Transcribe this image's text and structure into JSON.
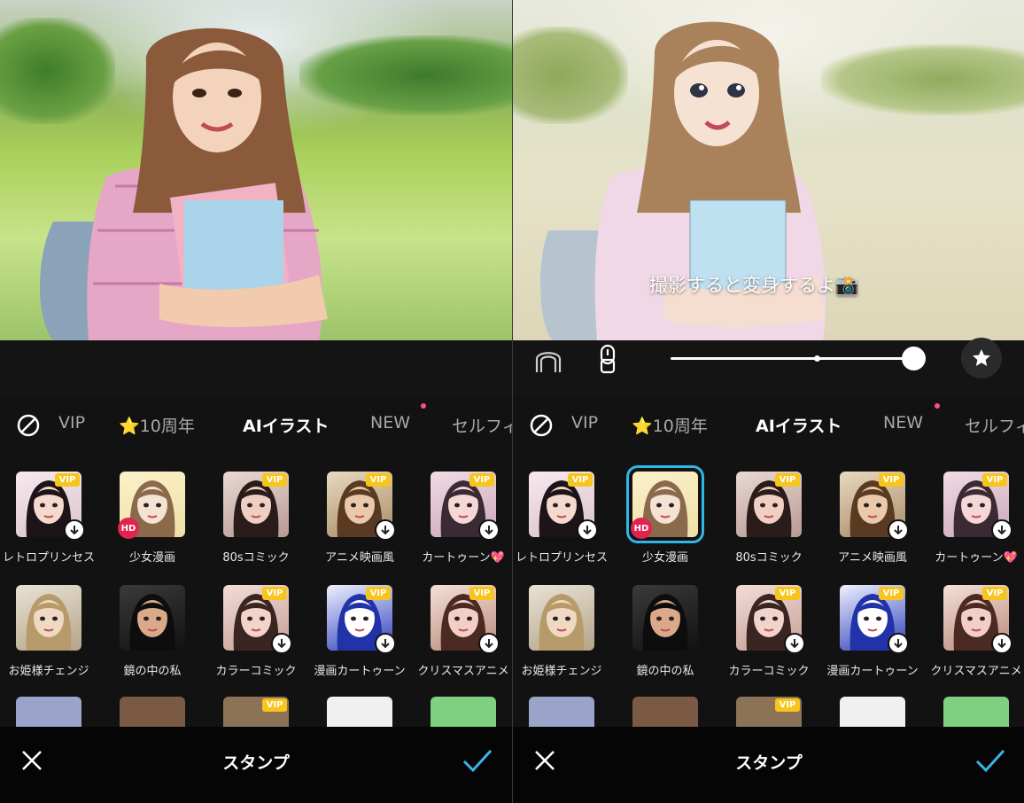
{
  "hint_text": "撮影すると変身するよ📸",
  "tabs": [
    {
      "label": "VIP"
    },
    {
      "label": "⭐10周年"
    },
    {
      "label": "AIイラスト"
    },
    {
      "label": "NEW"
    },
    {
      "label": "セルフィ"
    }
  ],
  "active_tab": "AIイラスト",
  "stickers": [
    {
      "label": "レトロプリンセス",
      "vip": true,
      "download": true,
      "hd": false
    },
    {
      "label": "少女漫画",
      "vip": false,
      "download": false,
      "hd": true
    },
    {
      "label": "80sコミック",
      "vip": true,
      "download": false,
      "hd": false
    },
    {
      "label": "アニメ映画風",
      "vip": true,
      "download": true,
      "hd": false
    },
    {
      "label": "カートゥーン💖",
      "vip": true,
      "download": true,
      "hd": false
    },
    {
      "label": "お姫様チェンジ",
      "vip": false,
      "download": false,
      "hd": false
    },
    {
      "label": "鏡の中の私",
      "vip": false,
      "download": false,
      "hd": false
    },
    {
      "label": "カラーコミック",
      "vip": true,
      "download": true,
      "hd": false
    },
    {
      "label": "漫画カートゥーン",
      "vip": true,
      "download": true,
      "hd": false
    },
    {
      "label": "クリスマスアニメ",
      "vip": true,
      "download": true,
      "hd": false
    }
  ],
  "badges": {
    "vip": "VIP",
    "hd": "HD"
  },
  "footer": {
    "title": "スタンプ"
  },
  "colors": {
    "accent_selection": "#2fb6ea",
    "vip_badge": "#f7c51c",
    "hd_badge": "#e0244f",
    "tab_dot": "#ff4f7a",
    "confirm_check": "#3db4ea"
  },
  "icons": {
    "none": "prohibit-icon",
    "face_outline": "face-outline-icon",
    "brush": "brush-icon",
    "favorite": "star-icon",
    "close": "close-icon",
    "confirm": "checkmark-icon",
    "download": "download-icon"
  }
}
